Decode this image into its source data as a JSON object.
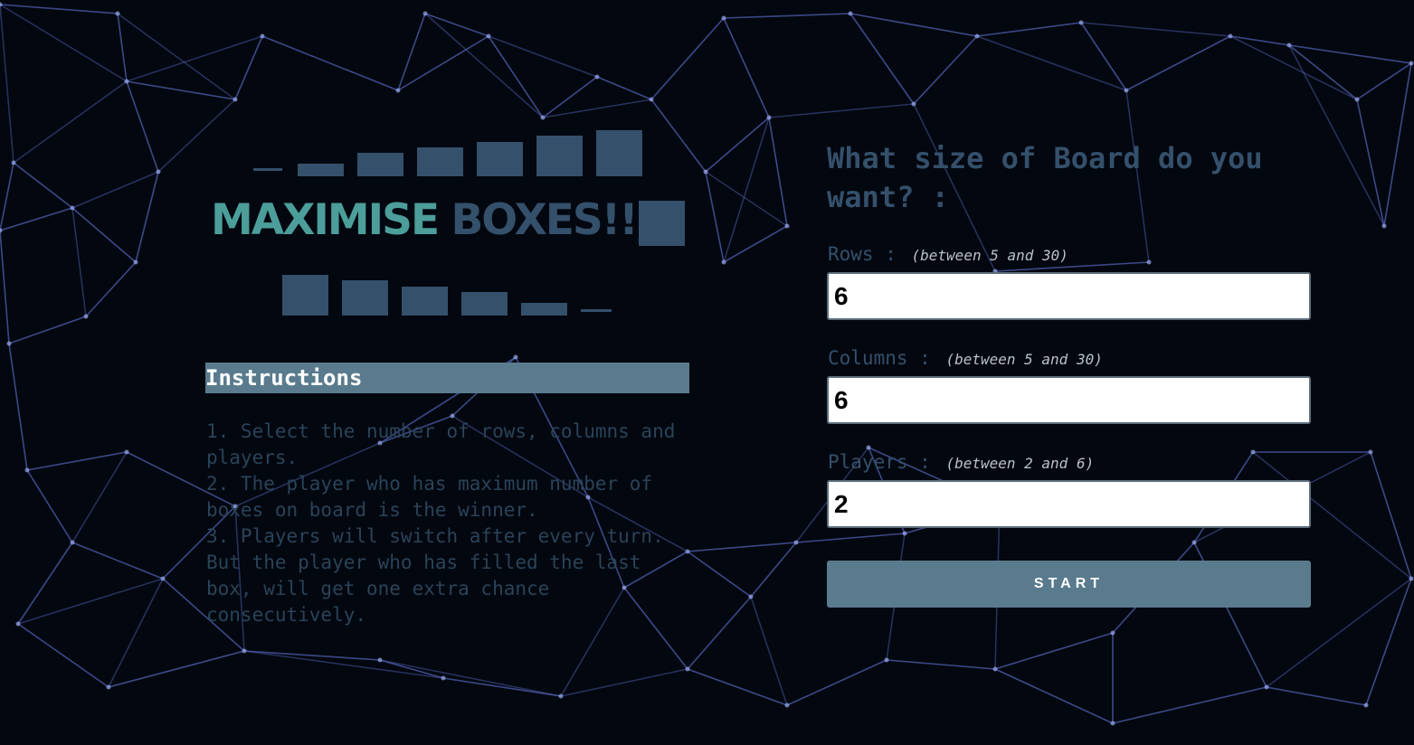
{
  "header": {
    "title_part1": "MAXIMISE",
    "title_part2": "BOXES!!"
  },
  "instructions": {
    "heading": "Instructions",
    "lines": [
      "1. Select the number of rows, columns and players.",
      "2. The player who has maximum number of boxes on board is the winner.",
      "3. Players will switch after every turn. But the player who has filled the last box, will get one extra chance consecutively."
    ]
  },
  "form": {
    "question": "What size of Board do you want? :",
    "rows": {
      "label": "Rows :",
      "hint": "(between 5 and 30)",
      "value": "6"
    },
    "columns": {
      "label": "Columns :",
      "hint": "(between 5 and 30)",
      "value": "6"
    },
    "players": {
      "label": "Players :",
      "hint": "(between 2 and 6)",
      "value": "2"
    },
    "start_label": "START"
  },
  "colors": {
    "background": "#03070f",
    "accent_teal": "#4c9e9a",
    "box_blue": "#34506b",
    "panel_slate": "#5a7b8e"
  }
}
